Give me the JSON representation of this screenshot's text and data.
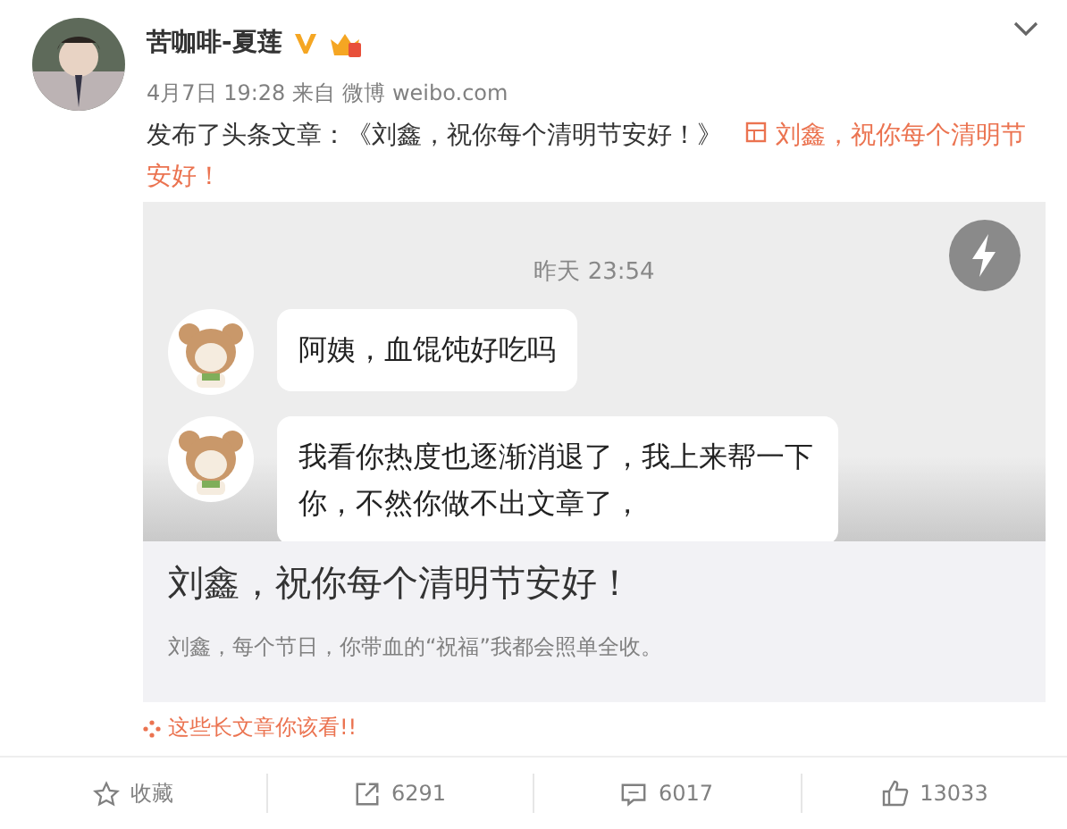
{
  "post": {
    "author": "苦咖啡-夏莲",
    "date": "4月7日 19:28",
    "source_prefix": "来自",
    "source": "微博 weibo.com",
    "text": "发布了头条文章：《刘鑫，祝你每个清明节安好！》",
    "link": "刘鑫，祝你每个清明节安好！"
  },
  "article": {
    "chat": {
      "time": "昨天 23:54",
      "messages": [
        "阿姨，血馄饨好吃吗",
        "我看你热度也逐渐消退了，我上来帮一下你，不然你做不出文章了，"
      ]
    },
    "title": "刘鑫，祝你每个清明节安好！",
    "summary": "刘鑫，每个节日，你带血的“祝福”我都会照单全收。"
  },
  "promo": "这些长文章你该看!!",
  "actions": [
    {
      "kind": "favorite",
      "label": "收藏"
    },
    {
      "kind": "repost",
      "label": "6291"
    },
    {
      "kind": "comment",
      "label": "6017"
    },
    {
      "kind": "like",
      "label": "13033"
    }
  ]
}
